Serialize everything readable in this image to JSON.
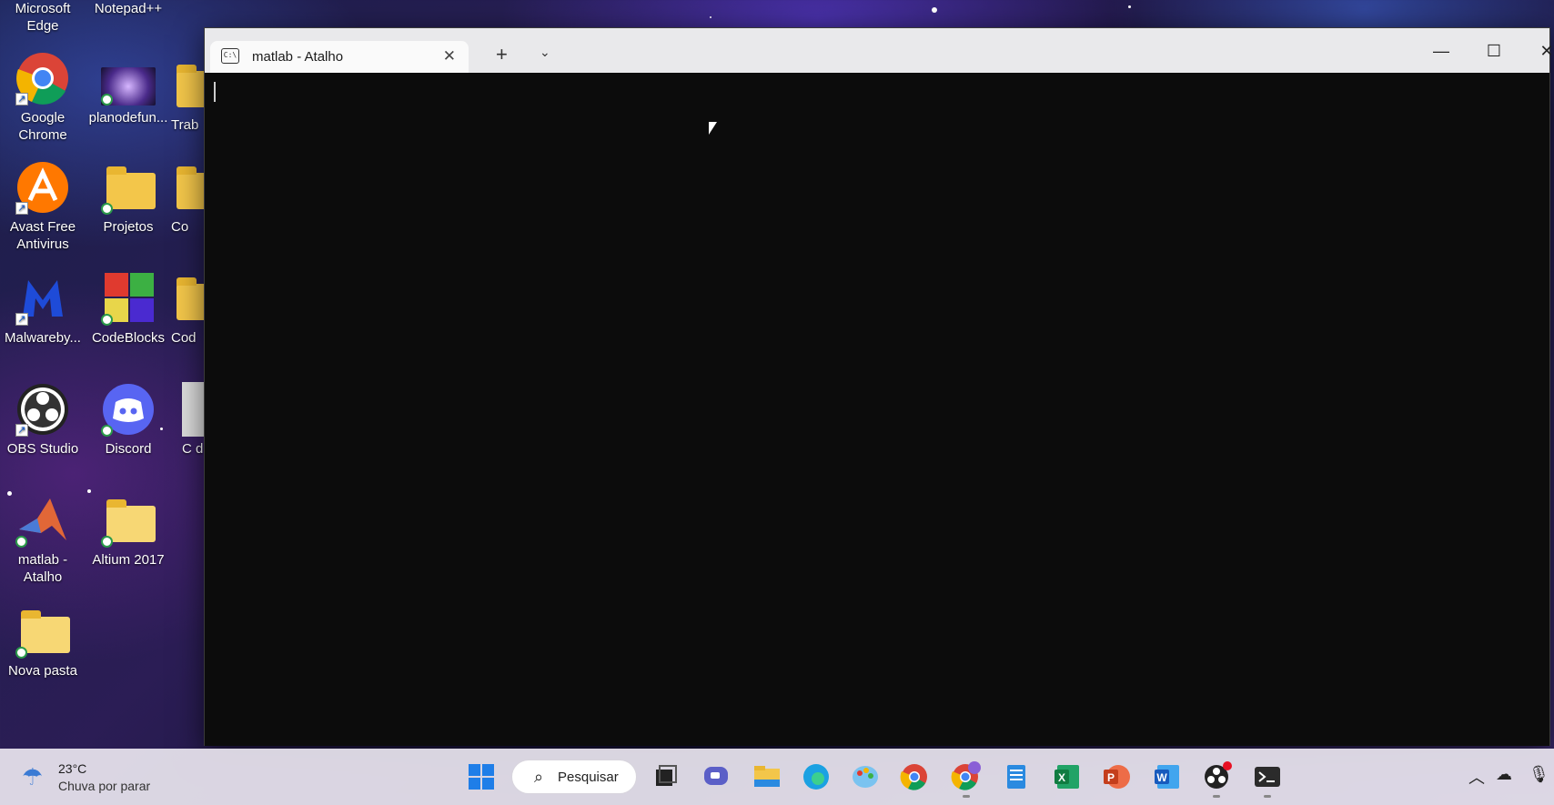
{
  "desktop": {
    "icons": [
      {
        "label": "Microsoft Edge",
        "icon": "edge-icon"
      },
      {
        "label": "Notepad++",
        "icon": "notepad-plus-plus-icon"
      },
      {
        "label": "Google Chrome",
        "icon": "chrome-icon"
      },
      {
        "label": "planodefun...",
        "icon": "image-file-icon"
      },
      {
        "label": "Trab",
        "icon": "folder-icon"
      },
      {
        "label": "Avast Free Antivirus",
        "icon": "avast-icon"
      },
      {
        "label": "Projetos",
        "icon": "folder-icon"
      },
      {
        "label": "Co",
        "icon": "folder-icon"
      },
      {
        "label": "Malwareby...",
        "icon": "malwarebytes-icon"
      },
      {
        "label": "CodeBlocks",
        "icon": "codeblocks-icon"
      },
      {
        "label": "Cod",
        "icon": "folder-icon"
      },
      {
        "label": "OBS Studio",
        "icon": "obs-icon"
      },
      {
        "label": "Discord",
        "icon": "discord-icon"
      },
      {
        "label": "C d",
        "icon": "file-icon"
      },
      {
        "label": "matlab - Atalho",
        "icon": "matlab-icon"
      },
      {
        "label": "Altium 2017",
        "icon": "folder-icon"
      },
      {
        "label": "Nova pasta",
        "icon": "folder-icon"
      }
    ]
  },
  "window": {
    "tab_title": "matlab - Atalho",
    "tab_icon_text": "C:\\",
    "new_tab_symbol": "+",
    "dropdown_symbol": "⌄",
    "minimize_symbol": "—",
    "maximize_symbol": "☐",
    "close_symbol": "✕",
    "background_color": "#0c0c0c"
  },
  "taskbar": {
    "weather": {
      "temp": "23°C",
      "condition": "Chuva por parar"
    },
    "search_label": "Pesquisar",
    "apps": [
      "start-icon",
      "task-view-icon",
      "teams-chat-icon",
      "file-explorer-icon",
      "edge-icon",
      "paint-icon",
      "chrome-icon",
      "chrome-profile-icon",
      "notepad-icon",
      "excel-icon",
      "powerpoint-icon",
      "word-icon",
      "obs-icon",
      "terminal-icon"
    ],
    "tray": [
      "chevron-up-icon",
      "onedrive-icon",
      "microphone-icon"
    ]
  }
}
